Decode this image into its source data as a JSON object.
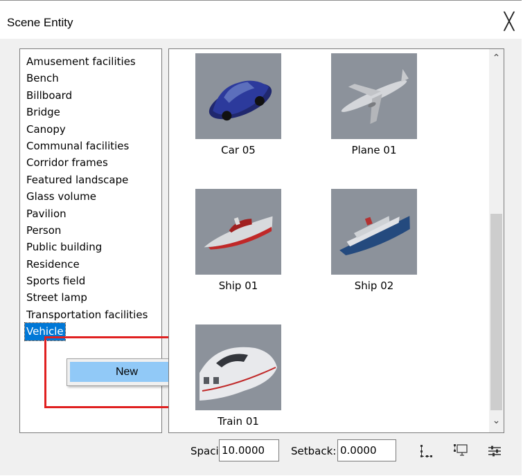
{
  "window": {
    "title": "Scene Entity",
    "close_glyph": "╳"
  },
  "categories": [
    "Amusement facilities",
    "Bench",
    "Billboard",
    "Bridge",
    "Canopy",
    "Communal facilities",
    "Corridor frames",
    "Featured landscape",
    "Glass volume",
    "Pavilion",
    "Person",
    "Public building",
    "Residence",
    "Sports field",
    "Street lamp",
    "Transportation facilities",
    "Vehicle"
  ],
  "selected_category": "Vehicle",
  "context_menu": {
    "item_new": "New"
  },
  "entities": [
    {
      "label": "Car 05",
      "icon": "car-thumbnail"
    },
    {
      "label": "Plane 01",
      "icon": "plane-thumbnail"
    },
    {
      "label": "Ship 01",
      "icon": "speedboat-thumbnail"
    },
    {
      "label": "Ship 02",
      "icon": "cruise-ship-thumbnail"
    },
    {
      "label": "Train 01",
      "icon": "train-thumbnail"
    }
  ],
  "scrollbar": {
    "up_glyph": "⌃",
    "down_glyph": "⌄"
  },
  "bottom": {
    "spacing_label": "Spacing:",
    "spacing_value": "10.0000",
    "setback_label": "Setback:",
    "setback_value": "0.0000",
    "tools": [
      "node-chain-icon",
      "screen-select-icon",
      "sliders-icon"
    ]
  },
  "colors": {
    "selection": "#0078d7",
    "menu_highlight": "#91c9f7",
    "annotation_red": "#e02020",
    "thumb_background": "#8c929b"
  }
}
